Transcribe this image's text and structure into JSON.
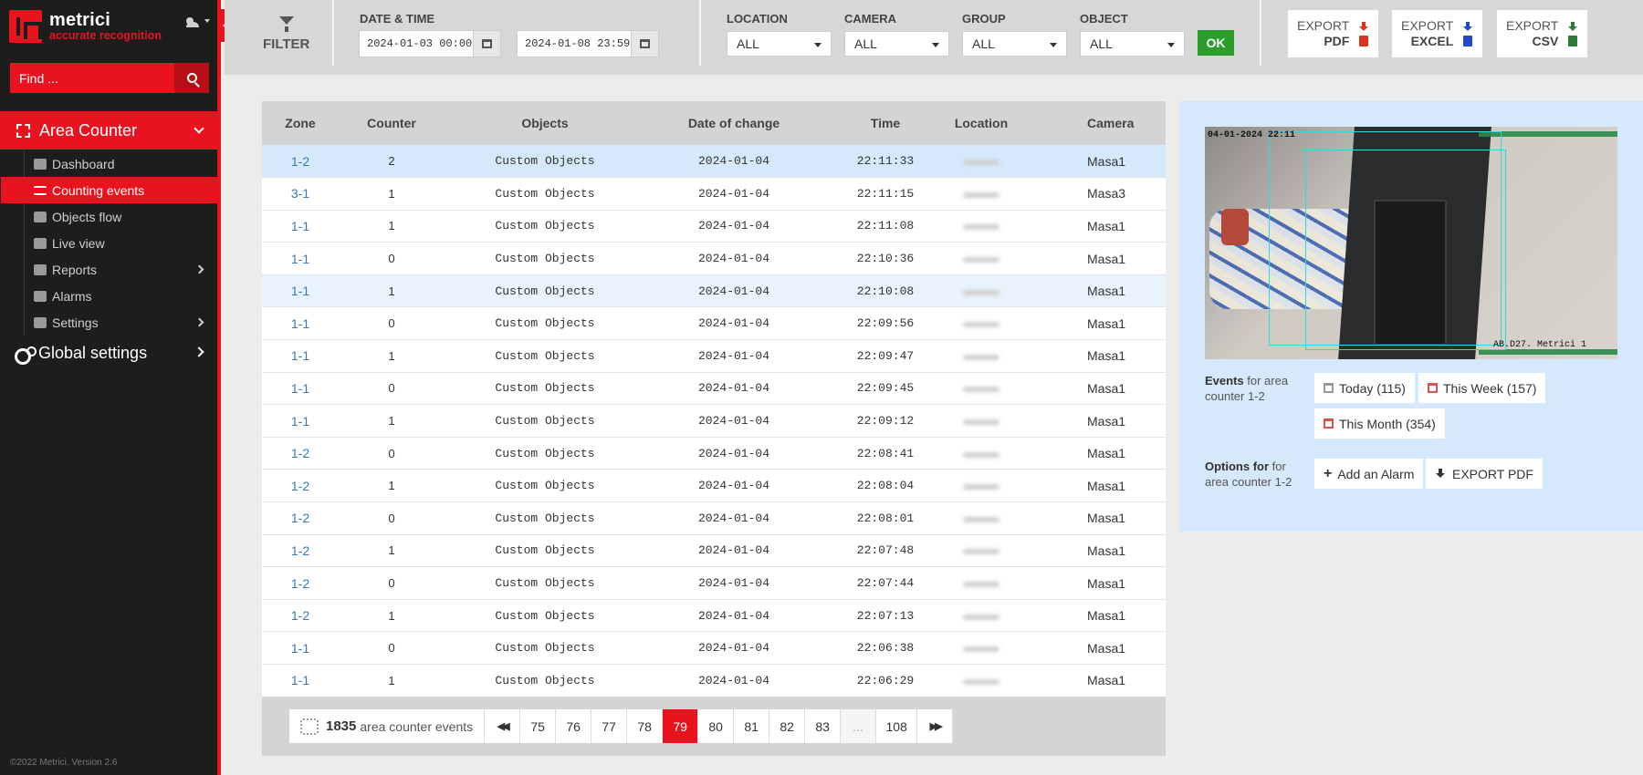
{
  "brand": {
    "name": "metrici",
    "tagline": "accurate recognition",
    "accent": "#e8131f"
  },
  "sidebar": {
    "search_placeholder": "Find ...",
    "section": "Area Counter",
    "items": [
      {
        "label": "Dashboard",
        "icon": "dashboard-icon"
      },
      {
        "label": "Counting events",
        "icon": "list-icon",
        "active": true
      },
      {
        "label": "Objects flow",
        "icon": "video-icon"
      },
      {
        "label": "Live view",
        "icon": "monitor-icon"
      },
      {
        "label": "Reports",
        "icon": "chart-icon"
      },
      {
        "label": "Alarms",
        "icon": "alarm-icon"
      },
      {
        "label": "Settings",
        "icon": "gear-icon"
      }
    ],
    "global": "Global settings",
    "footer": "©2022 Metrici. Version 2.6"
  },
  "filter": {
    "title": "FILTER",
    "date_label": "DATE & TIME",
    "date_from": "2024-01-03 00:00",
    "date_to": "2024-01-08 23:59",
    "location_label": "LOCATION",
    "location": "ALL",
    "camera_label": "CAMERA",
    "camera": "ALL",
    "group_label": "GROUP",
    "group": "ALL",
    "object_label": "OBJECT",
    "object": "ALL",
    "ok": "OK"
  },
  "exports": [
    {
      "top": "EXPORT",
      "bottom": "PDF",
      "color": "#d9341f"
    },
    {
      "top": "EXPORT",
      "bottom": "EXCEL",
      "color": "#2449c4"
    },
    {
      "top": "EXPORT",
      "bottom": "CSV",
      "color": "#2f7a3a"
    }
  ],
  "table": {
    "headers": [
      "Zone",
      "Counter",
      "Objects",
      "Date of change",
      "Time",
      "Location",
      "Camera"
    ],
    "rows": [
      [
        "1-2",
        "2",
        "Custom Objects",
        "2024-01-04",
        "22:11:33",
        "",
        "Masa1"
      ],
      [
        "3-1",
        "1",
        "Custom Objects",
        "2024-01-04",
        "22:11:15",
        "",
        "Masa3"
      ],
      [
        "1-1",
        "1",
        "Custom Objects",
        "2024-01-04",
        "22:11:08",
        "",
        "Masa1"
      ],
      [
        "1-1",
        "0",
        "Custom Objects",
        "2024-01-04",
        "22:10:36",
        "",
        "Masa1"
      ],
      [
        "1-1",
        "1",
        "Custom Objects",
        "2024-01-04",
        "22:10:08",
        "",
        "Masa1"
      ],
      [
        "1-1",
        "0",
        "Custom Objects",
        "2024-01-04",
        "22:09:56",
        "",
        "Masa1"
      ],
      [
        "1-1",
        "1",
        "Custom Objects",
        "2024-01-04",
        "22:09:47",
        "",
        "Masa1"
      ],
      [
        "1-1",
        "0",
        "Custom Objects",
        "2024-01-04",
        "22:09:45",
        "",
        "Masa1"
      ],
      [
        "1-1",
        "1",
        "Custom Objects",
        "2024-01-04",
        "22:09:12",
        "",
        "Masa1"
      ],
      [
        "1-2",
        "0",
        "Custom Objects",
        "2024-01-04",
        "22:08:41",
        "",
        "Masa1"
      ],
      [
        "1-2",
        "1",
        "Custom Objects",
        "2024-01-04",
        "22:08:04",
        "",
        "Masa1"
      ],
      [
        "1-2",
        "0",
        "Custom Objects",
        "2024-01-04",
        "22:08:01",
        "",
        "Masa1"
      ],
      [
        "1-2",
        "1",
        "Custom Objects",
        "2024-01-04",
        "22:07:48",
        "",
        "Masa1"
      ],
      [
        "1-2",
        "0",
        "Custom Objects",
        "2024-01-04",
        "22:07:44",
        "",
        "Masa1"
      ],
      [
        "1-2",
        "1",
        "Custom Objects",
        "2024-01-04",
        "22:07:13",
        "",
        "Masa1"
      ],
      [
        "1-1",
        "0",
        "Custom Objects",
        "2024-01-04",
        "22:06:38",
        "",
        "Masa1"
      ],
      [
        "1-1",
        "1",
        "Custom Objects",
        "2024-01-04",
        "22:06:29",
        "",
        "Masa1"
      ]
    ]
  },
  "pager": {
    "count": "1835",
    "count_label": "area counter events",
    "pages": [
      "75",
      "76",
      "77",
      "78",
      "79",
      "80",
      "81",
      "82",
      "83",
      "...",
      "108"
    ],
    "active": "79"
  },
  "panel": {
    "cam_timestamp": "04-01-2024 22:11",
    "cam_label": "AB.D27. Metrici 1",
    "events_bold": "Events",
    "events_text": "for area counter 1-2",
    "today": "Today (115)",
    "week": "This Week (157)",
    "month": "This Month (354)",
    "options_bold": "Options for",
    "options_text": "for area counter 1-2",
    "add_alarm": "Add an Alarm",
    "export_pdf": "EXPORT PDF"
  }
}
